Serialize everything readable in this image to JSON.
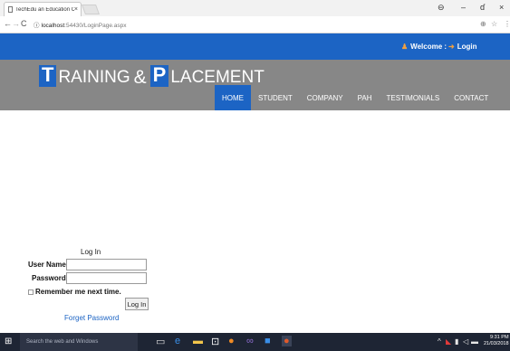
{
  "browser": {
    "tab_title": "TechEdu an Education C",
    "tab_close": "×",
    "url_host": "localhost",
    "url_path": ":54430/LoginPage.aspx",
    "window_controls": {
      "account": "⊖",
      "minimize": "–",
      "maximize": "ɗ",
      "close": "×"
    },
    "nav": {
      "back": "←",
      "forward": "→",
      "reload": "C",
      "info": "ⓘ"
    },
    "addr_icons": {
      "zoom": "⊕",
      "star": "☆",
      "menu": "⋮"
    }
  },
  "topbar": {
    "welcome_label": "Welcome :",
    "login_label": "Login"
  },
  "logo": {
    "letter1": "T",
    "word1": "RAINING",
    "amp": "&",
    "letter2": "P",
    "word2": "LACEMENT"
  },
  "menu": {
    "items": [
      "HOME",
      "STUDENT",
      "COMPANY",
      "PAH",
      "TESTIMONIALS",
      "CONTACT"
    ],
    "active": "HOME"
  },
  "login_form": {
    "title": "Log In",
    "username_label": "User Name:",
    "username_value": "",
    "password_label": "Password:",
    "password_value": "",
    "remember_label": "Remember me next time.",
    "submit_label": "Log In",
    "forget_label": "Forget Password"
  },
  "taskbar": {
    "search_placeholder": "Search the web and Windows",
    "time": "9:31 PM",
    "date": "21/03/2018"
  },
  "colors": {
    "brand_blue": "#1c64c4",
    "header_grey": "#878787",
    "taskbar": "#1e2534"
  }
}
